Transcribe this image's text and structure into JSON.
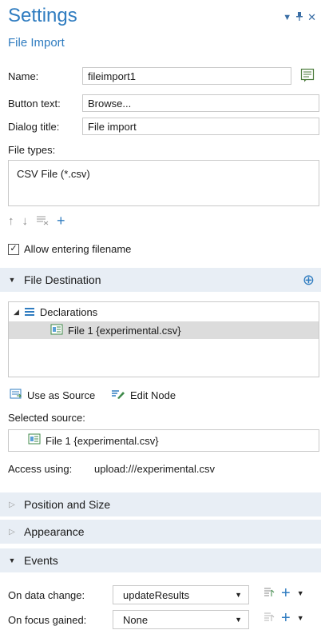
{
  "header": {
    "title": "Settings",
    "subtitle": "File Import"
  },
  "form": {
    "name_label": "Name:",
    "name_value": "fileimport1",
    "button_text_label": "Button text:",
    "button_text_value": "Browse...",
    "dialog_title_label": "Dialog title:",
    "dialog_title_value": "File import",
    "file_types_label": "File types:",
    "file_types": [
      "CSV File (*.csv)"
    ],
    "allow_filename_label": "Allow entering filename",
    "allow_filename_checked": true
  },
  "file_destination": {
    "header": "File Destination",
    "tree": {
      "root": "Declarations",
      "child": "File 1 {experimental.csv}"
    },
    "use_as_source_label": "Use as Source",
    "edit_node_label": "Edit Node",
    "selected_source_label": "Selected source:",
    "selected_source_value": "File 1 {experimental.csv}",
    "access_using_label": "Access using:",
    "access_using_value": "upload:///experimental.csv"
  },
  "sections": {
    "position_size": "Position and Size",
    "appearance": "Appearance",
    "events": "Events"
  },
  "events": {
    "on_data_change_label": "On data change:",
    "on_data_change_value": "updateResults",
    "on_focus_gained_label": "On focus gained:",
    "on_focus_gained_value": "None"
  },
  "colors": {
    "accent": "#2f7cc0",
    "section_bg": "#e8eef5",
    "selected_row": "#dcdcdc"
  }
}
